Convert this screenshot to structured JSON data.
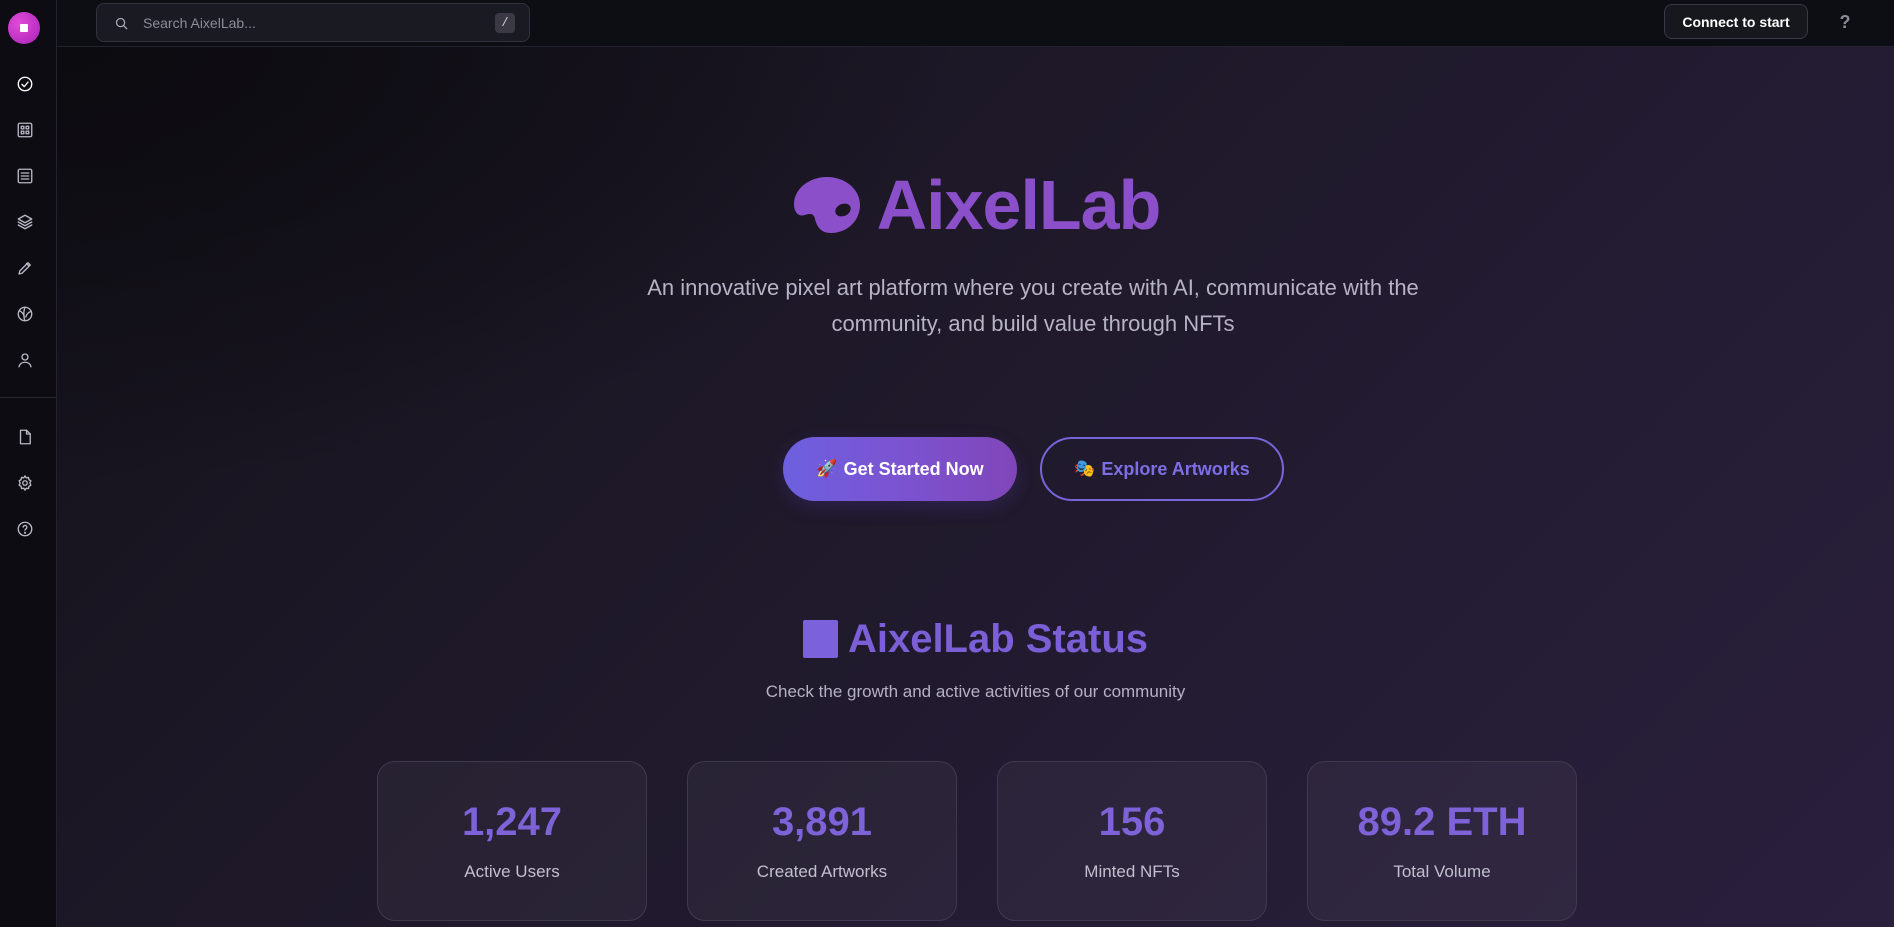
{
  "topbar": {
    "search_placeholder": "Search AixelLab...",
    "search_shortcut": "/",
    "connect_label": "Connect to start",
    "help_label": "?"
  },
  "sidebar": {
    "primary_icons": [
      "check-circle-icon",
      "grid-icon",
      "list-icon",
      "layers-icon",
      "pencil-icon",
      "globe-icon",
      "user-icon"
    ],
    "secondary_icons": [
      "file-icon",
      "gear-icon",
      "help-circle-icon"
    ]
  },
  "hero": {
    "title": "AixelLab",
    "subtitle": "An innovative pixel art platform where you create with AI, communicate with the community, and build value through NFTs",
    "primary_emoji": "🚀",
    "primary_label": "Get Started Now",
    "secondary_emoji": "🎭",
    "secondary_label": "Explore Artworks"
  },
  "status": {
    "title": "AixelLab Status",
    "subtitle": "Check the growth and active activities of our community",
    "stats": [
      {
        "value": "1,247",
        "label": "Active Users"
      },
      {
        "value": "3,891",
        "label": "Created Artworks"
      },
      {
        "value": "156",
        "label": "Minted NFTs"
      },
      {
        "value": "89.2 ETH",
        "label": "Total Volume"
      }
    ]
  },
  "colors": {
    "accent": "#7b5fd6",
    "brand_gradient_start": "#6d60e0",
    "brand_gradient_end": "#8046b8",
    "logo": "#c22fcf"
  }
}
